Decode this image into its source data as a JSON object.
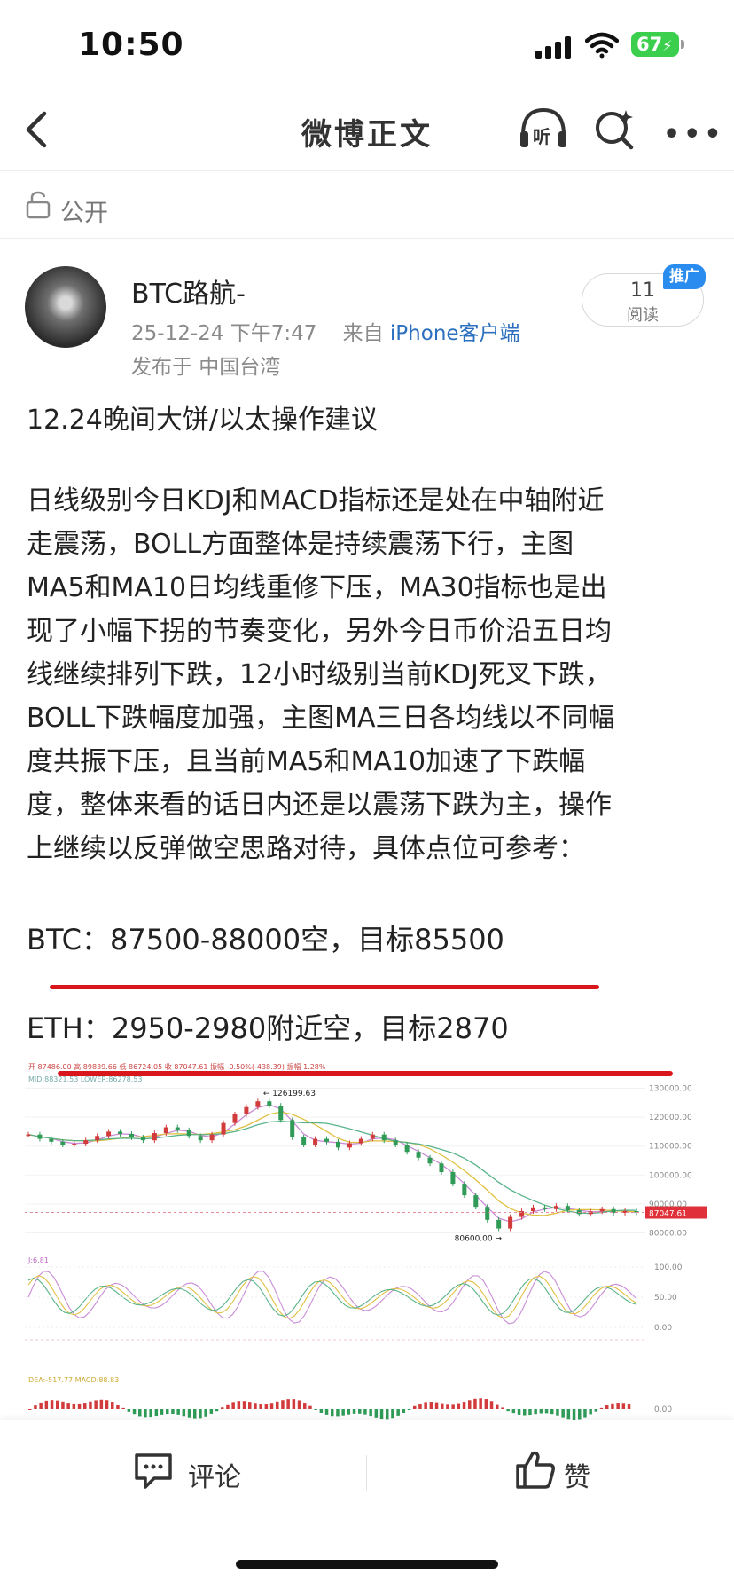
{
  "status_bar": {
    "time": "10:50",
    "battery": "67",
    "icons": [
      "cellular-signal-icon",
      "wifi-icon",
      "battery-charging-icon"
    ]
  },
  "nav": {
    "title": "微博正文",
    "listen_label": "听",
    "icons": [
      "back-chevron-icon",
      "headphones-listen-icon",
      "search-sparkle-icon",
      "more-dots-icon"
    ]
  },
  "visibility": {
    "label": "公开",
    "icon": "unlock-icon"
  },
  "author": {
    "name": "BTC路航-",
    "timestamp": "25-12-24 下午7:47",
    "source_prefix": "来自",
    "source": "iPhone客户端",
    "location": "发布于 中国台湾",
    "read_count": "11",
    "read_label": "阅读",
    "promo_badge": "推广"
  },
  "post": {
    "title": "12.24晚间大饼/以太操作建议",
    "paragraph_lines": [
      "日线级别今日KDJ和MACD指标还是处在中轴附近",
      "走震荡，BOLL方面整体是持续震荡下行，主图",
      "MA5和MA10日均线重修下压，MA30指标也是出",
      "现了小幅下拐的节奏变化，另外今日币价沿五日均",
      "线继续排列下跌，12小时级别当前KDJ死叉下跌，",
      "BOLL下跌幅度加强，主图MA三日各均线以不同幅",
      "度共振下压，且当前MA5和MA10加速了下跌幅",
      "度，整体来看的话日内还是以震荡下跌为主，操作",
      "上继续以反弹做空思路对待，具体点位可参考："
    ],
    "btc_call": "BTC：87500-88000空，目标85500",
    "eth_call": "ETH：2950-2980附近空，目标2870"
  },
  "chart_data": {
    "type": "line",
    "header_text": "开 87486.00  高 89839.66  低 86724.05  收 87047.61  振幅 -0.50%(-438.39)  振幅 1.28%",
    "boll_text": "MID:88321.53  LOWER:86278.53",
    "kdj_text": "J:6.81",
    "macd_text": "DEA:-517.77  MACD:88.83",
    "price_ticks": [
      "130000.00",
      "120000.00",
      "110000.00",
      "100000.00",
      "90000.00",
      "80000.00"
    ],
    "price_ylim": [
      78000,
      132000
    ],
    "current_price": "87047.61",
    "annotations": {
      "high": "126199.63",
      "low": "80600.00"
    },
    "kdj_ticks": [
      "100.00",
      "50.00",
      "0.00"
    ],
    "macd_ticks": [
      "0.00"
    ],
    "price_series": [
      114000,
      112500,
      111500,
      110500,
      110800,
      112000,
      113500,
      115000,
      114200,
      113000,
      112000,
      114500,
      116500,
      115500,
      113500,
      112000,
      114000,
      118000,
      121000,
      123500,
      125500,
      124000,
      119000,
      113000,
      110500,
      112500,
      111500,
      109500,
      111000,
      112500,
      114000,
      112000,
      110500,
      108000,
      106000,
      104000,
      101000,
      97000,
      93000,
      89000,
      84500,
      81500,
      85500,
      87500,
      88800,
      88200,
      89300,
      87800,
      86500,
      87400,
      88200,
      86900,
      87500,
      87047
    ]
  },
  "actions": {
    "comment_label": "评论",
    "like_label": "赞",
    "icons": [
      "comment-bubble-icon",
      "thumbs-up-icon"
    ]
  },
  "colors": {
    "link_blue": "#2b6fbf",
    "promo_blue": "#2b8cf0",
    "annotation_red": "#d9161c",
    "battery_green": "#3ccf4e"
  }
}
